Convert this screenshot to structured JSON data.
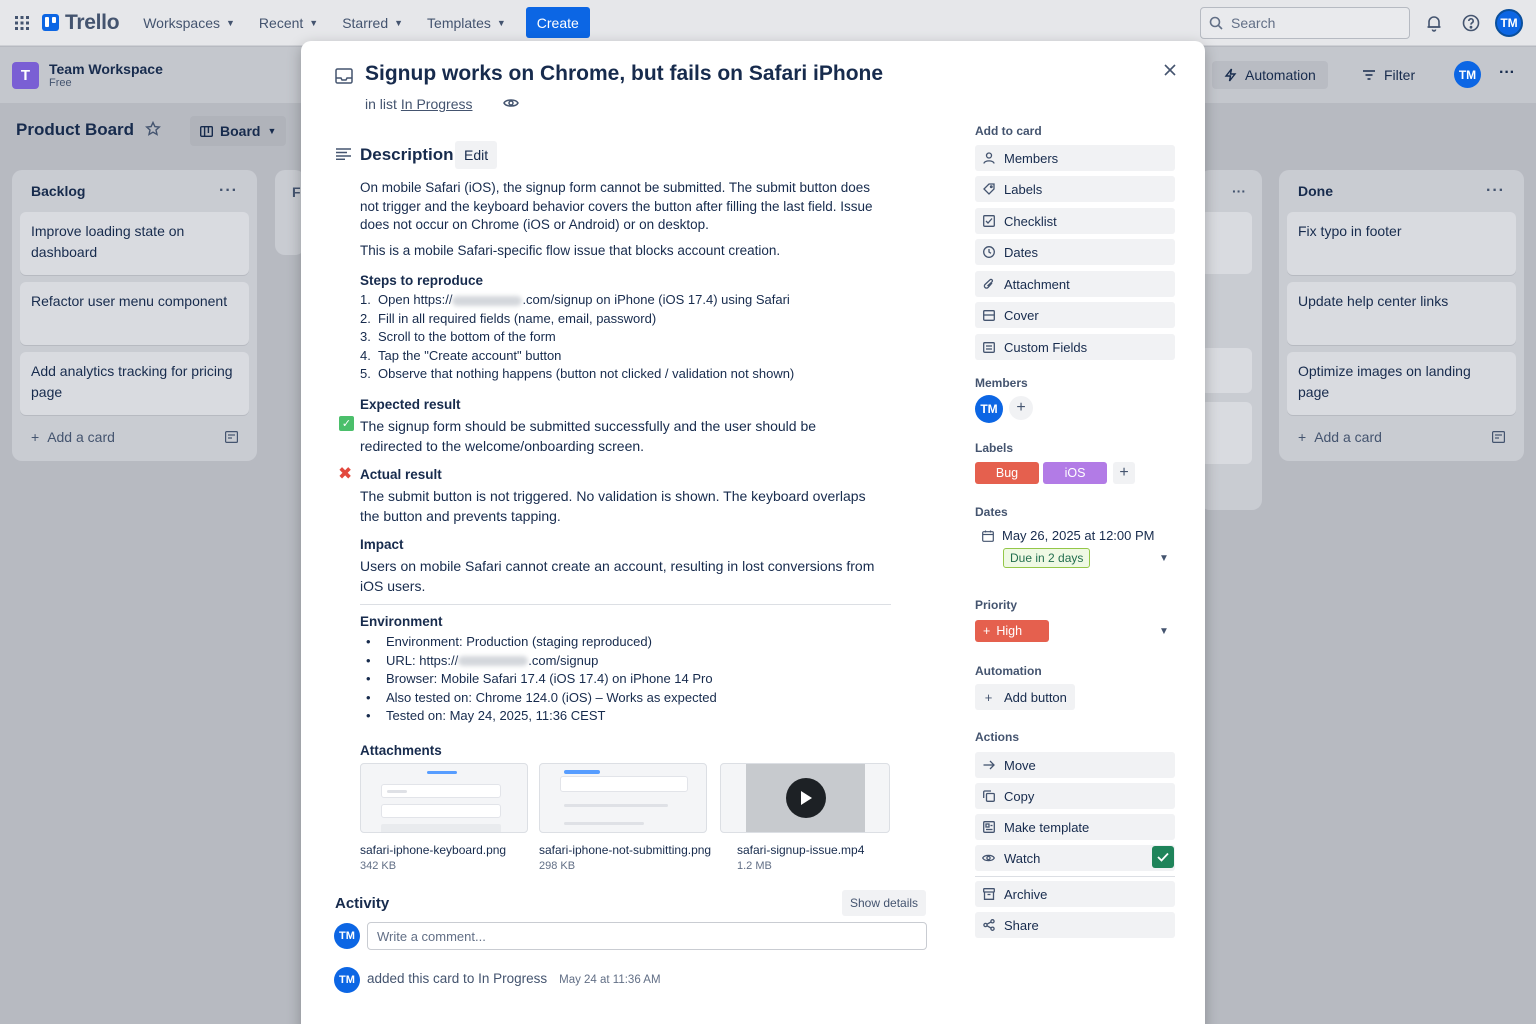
{
  "topnav": {
    "logo": "Trello",
    "items": [
      "Workspaces",
      "Recent",
      "Starred",
      "Templates"
    ],
    "create_label": "Create",
    "search_placeholder": "Search",
    "avatar": "TM"
  },
  "workspace": {
    "badge": "T",
    "name": "Team Workspace",
    "plan": "Free",
    "automation": "Automation",
    "filter": "Filter",
    "avatar": "TM",
    "more": "···"
  },
  "board": {
    "title": "Product Board",
    "view": "Board"
  },
  "lists": {
    "backlog": {
      "title": "Backlog",
      "cards": [
        "Improve loading state on dashboard",
        "Refactor user menu component",
        "Add analytics tracking for pricing page"
      ],
      "add": "Add a card"
    },
    "partial_letter": "F",
    "done": {
      "title": "Done",
      "cards": [
        "Fix typo in footer",
        "Update help center links",
        "Optimize images on landing page"
      ],
      "add": "Add a card"
    }
  },
  "modal": {
    "title": "Signup works on Chrome, but fails on Safari iPhone",
    "in_list_prefix": "in list",
    "in_list_name": "In Progress",
    "description_heading": "Description",
    "edit_label": "Edit",
    "desc_p1": "On mobile Safari (iOS), the signup form cannot be submitted. The submit button does not trigger and the keyboard behavior covers the button after filling the last field. Issue does not occur on Chrome (iOS or Android) or on desktop.",
    "desc_p2": "This is a mobile Safari-specific flow issue that blocks account creation.",
    "steps_heading": "Steps to reproduce",
    "steps": {
      "s1_num": "1.",
      "s1_pre": "Open https://",
      "s1_post": ".com/signup on iPhone (iOS 17.4) using Safari",
      "s2": "Fill in all required fields (name, email, password)",
      "s3": "Scroll to the bottom of the form",
      "s4": "Tap the \"Create account\" button",
      "s5": "Observe that nothing happens (button not clicked / validation not shown)"
    },
    "expected_heading": "Expected result",
    "expected_text": "The signup form should be submitted successfully and the user should be redirected to the welcome/onboarding screen.",
    "actual_heading": "Actual result",
    "actual_text": "The submit button is not triggered. No validation is shown. The keyboard overlaps the button and prevents tapping.",
    "impact_heading": "Impact",
    "impact_text": "Users on mobile Safari cannot create an account, resulting in lost conversions from iOS users.",
    "environment_heading": "Environment",
    "environment": {
      "env": "Environment: Production (staging reproduced)",
      "url_pre": "URL: https://",
      "url_post": ".com/signup",
      "browser": "Browser: Mobile Safari 17.4 (iOS 17.4) on iPhone 14 Pro",
      "also": "Also tested on: Chrome 124.0 (iOS) – Works as expected",
      "tested": "Tested on: May 24, 2025, 11:36 CEST"
    },
    "attachments_heading": "Attachments",
    "attachments": [
      {
        "name": "safari-iphone-keyboard.png",
        "size": "342 KB"
      },
      {
        "name": "safari-iphone-not-submitting.png",
        "size": "298 KB"
      },
      {
        "name": "safari-signup-issue.mp4",
        "size": "1.2 MB"
      }
    ],
    "activity_heading": "Activity",
    "show_details": "Show details",
    "comment_placeholder": "Write a comment...",
    "activity_avatar": "TM",
    "activity_text": "added this card to In Progress",
    "activity_time": "May 24 at 11:36 AM"
  },
  "sidebar": {
    "add_to_card": "Add to card",
    "add_items": [
      "Members",
      "Labels",
      "Checklist",
      "Dates",
      "Attachment",
      "Cover",
      "Custom Fields"
    ],
    "members_heading": "Members",
    "member_avatar": "TM",
    "labels_heading": "Labels",
    "labels": [
      {
        "text": "Bug",
        "color": "#e5604e"
      },
      {
        "text": "iOS",
        "color": "#b27be6"
      }
    ],
    "dates_heading": "Dates",
    "date_value": "May 26, 2025 at 12:00 PM",
    "due_badge": "Due in 2 days",
    "priority_heading": "Priority",
    "priority_value": "High",
    "automation_heading": "Automation",
    "add_button": "Add button",
    "actions_heading": "Actions",
    "actions": [
      "Move",
      "Copy",
      "Make template",
      "Watch",
      "Archive",
      "Share"
    ]
  },
  "colors": {
    "brand": "#0c66e4",
    "label_bug": "#e5604e",
    "label_ios": "#b27be6",
    "priority_high": "#e5604e",
    "watch_check": "#1f845a"
  }
}
